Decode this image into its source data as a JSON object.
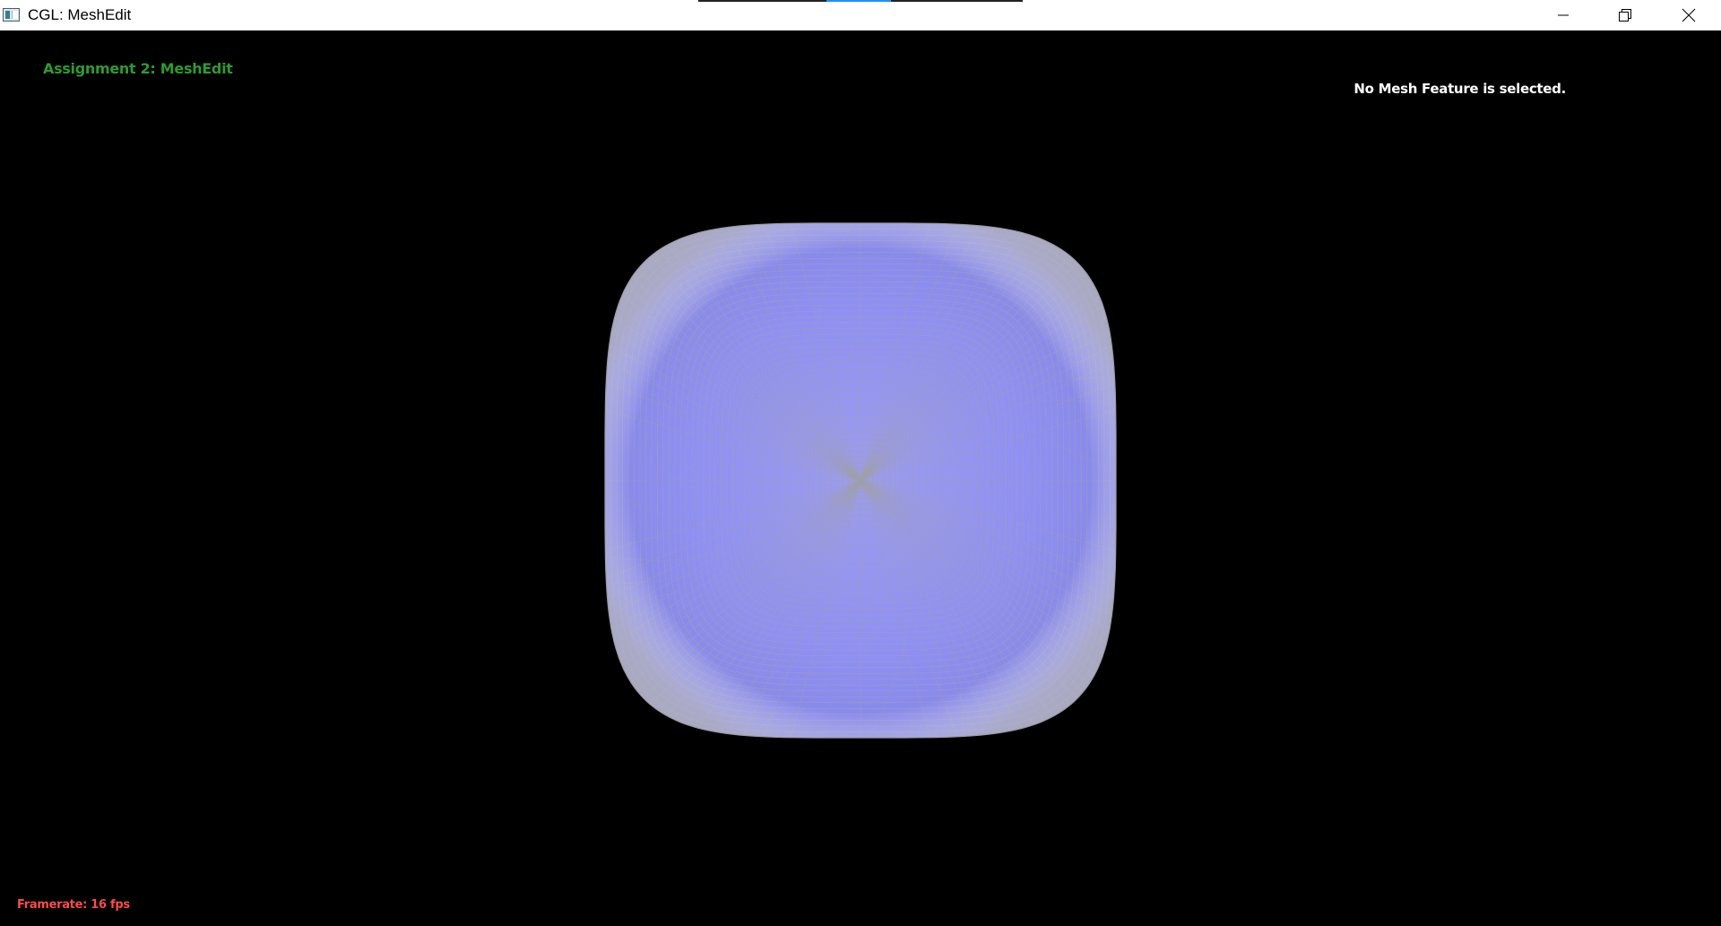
{
  "window": {
    "title": "CGL: MeshEdit",
    "icon": "app-window-icon",
    "controls": {
      "minimize_icon": "minimize-icon",
      "restore_icon": "restore-icon",
      "close_icon": "close-icon"
    }
  },
  "viewport": {
    "background": "#000000",
    "assignment_title": "Assignment 2: MeshEdit",
    "assignment_title_color": "#2e9b2e",
    "selection_status": "No Mesh Feature is selected.",
    "selection_status_color": "#ffffff",
    "framerate_label": "Framerate:",
    "framerate_value": "16 fps",
    "framerate_color": "#ff4a4a"
  },
  "mesh": {
    "shape": "subdivided-cube",
    "fill_color": "#8f8fff",
    "wireframe_color": "#a0a0a8",
    "render_mode": "shaded-with-wireframe"
  }
}
